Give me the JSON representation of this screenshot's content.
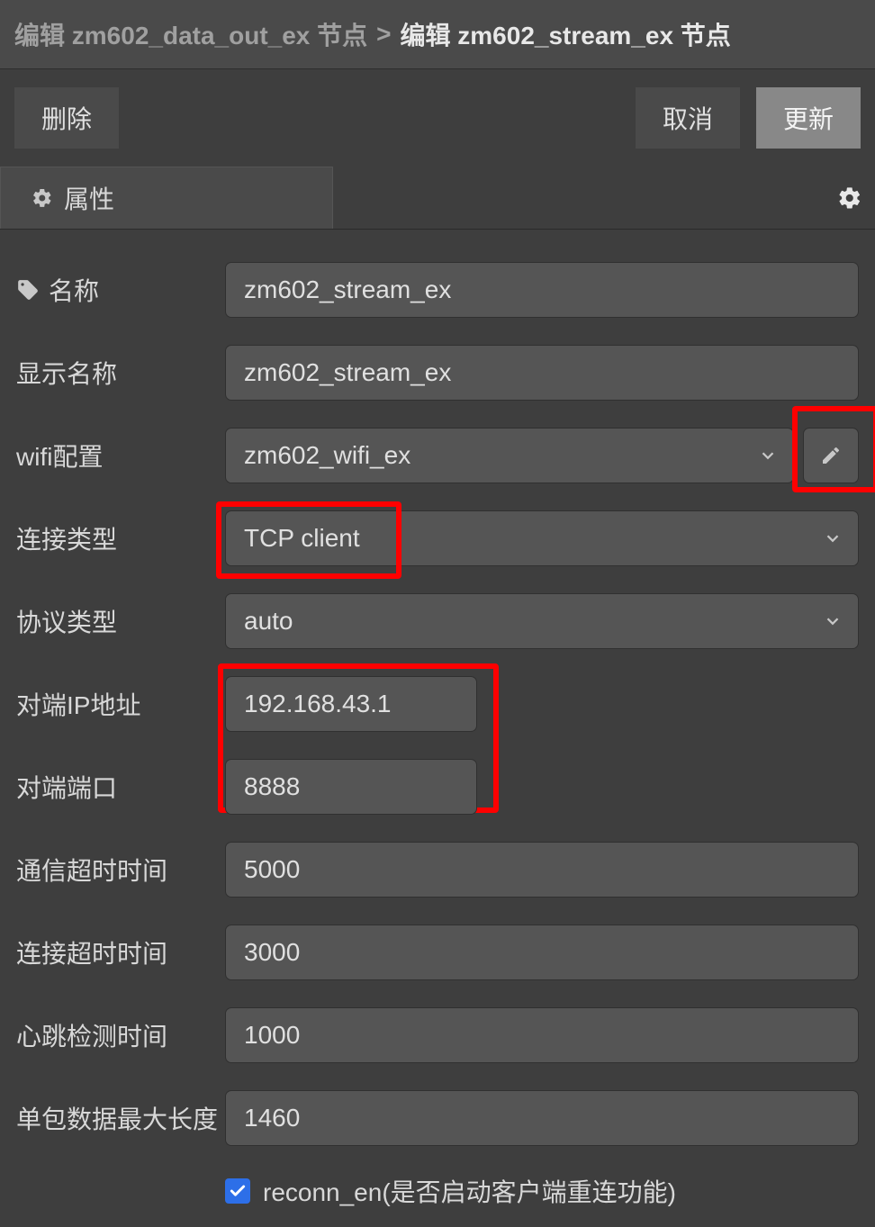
{
  "breadcrumb": {
    "previous": "编辑 zm602_data_out_ex 节点",
    "separator": ">",
    "current": "编辑 zm602_stream_ex 节点"
  },
  "buttons": {
    "delete": "删除",
    "cancel": "取消",
    "update": "更新"
  },
  "tab": {
    "properties_label": "属性"
  },
  "form": {
    "name": {
      "label": "名称",
      "value": "zm602_stream_ex"
    },
    "display_name": {
      "label": "显示名称",
      "value": "zm602_stream_ex"
    },
    "wifi_config": {
      "label": "wifi配置",
      "value": "zm602_wifi_ex"
    },
    "conn_type": {
      "label": "连接类型",
      "value": "TCP client"
    },
    "proto_type": {
      "label": "协议类型",
      "value": "auto"
    },
    "peer_ip": {
      "label": "对端IP地址",
      "value": "192.168.43.1"
    },
    "peer_port": {
      "label": "对端端口",
      "value": "8888"
    },
    "comm_timeout": {
      "label": "通信超时时间",
      "value": "5000"
    },
    "conn_timeout": {
      "label": "连接超时时间",
      "value": "3000"
    },
    "heartbeat": {
      "label": "心跳检测时间",
      "value": "1000"
    },
    "max_packet": {
      "label": "单包数据最大长度",
      "value": "1460"
    },
    "reconn_en": {
      "label": "reconn_en(是否启动客户端重连功能)",
      "checked": true
    }
  }
}
